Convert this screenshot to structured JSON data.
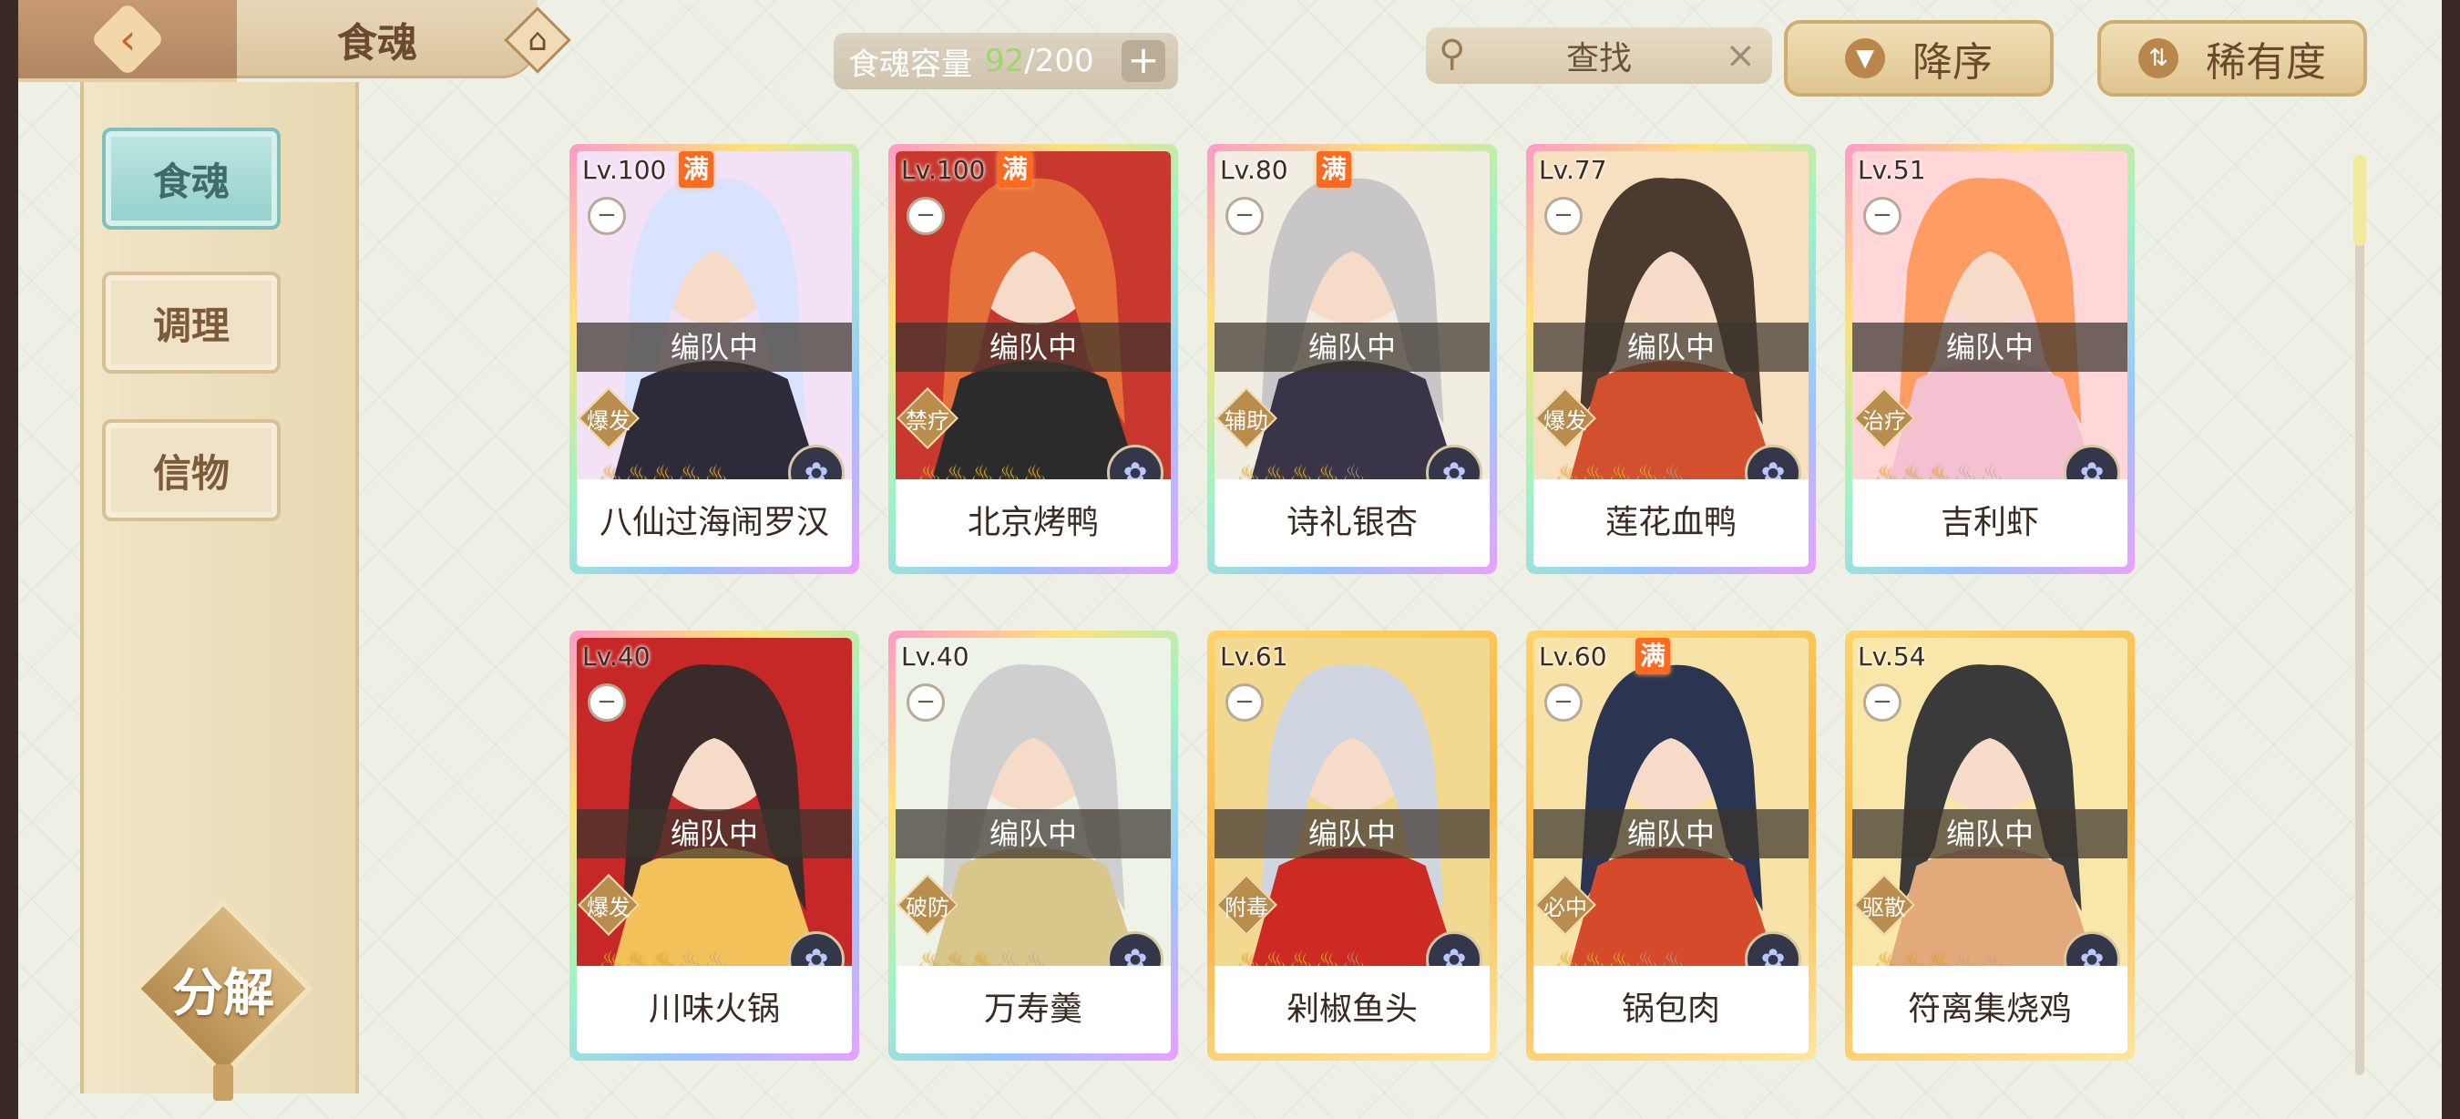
{
  "header": {
    "title": "食魂",
    "capacity_label": "食魂容量",
    "capacity_current": "92",
    "capacity_max": "/200",
    "capacity_add": "+",
    "search_placeholder": "查找",
    "search_clear": "×",
    "sort_order_label": "降序",
    "sort_key_label": "稀有度"
  },
  "sidebar": {
    "tabs": [
      {
        "label": "食魂",
        "active": true
      },
      {
        "label": "调理",
        "active": false
      },
      {
        "label": "信物",
        "active": false
      }
    ],
    "decompose_label": "分解"
  },
  "cards": [
    {
      "level": "Lv.100",
      "max": "满",
      "team": "编队中",
      "role": "爆发",
      "stars": 5,
      "name": "八仙过海闹罗汉",
      "rarity": "ur",
      "palette": [
        "#f3e1f5",
        "#d9e2ff",
        "#2d2a3a"
      ]
    },
    {
      "level": "Lv.100",
      "max": "满",
      "team": "编队中",
      "role": "禁疗",
      "stars": 5,
      "name": "北京烤鸭",
      "rarity": "ur",
      "palette": [
        "#c8382f",
        "#e6703a",
        "#2b2b2b"
      ]
    },
    {
      "level": "Lv.80",
      "max": "满",
      "team": "编队中",
      "role": "辅助",
      "stars": 4,
      "name": "诗礼银杏",
      "rarity": "ur",
      "palette": [
        "#f1ede2",
        "#c9c6c8",
        "#3a3448"
      ]
    },
    {
      "level": "Lv.77",
      "max": "",
      "team": "编队中",
      "role": "爆发",
      "stars": 4,
      "name": "莲花血鸭",
      "rarity": "ur",
      "palette": [
        "#f7e0c0",
        "#4a3a30",
        "#d2502e"
      ]
    },
    {
      "level": "Lv.51",
      "max": "",
      "team": "编队中",
      "role": "治疗",
      "stars": 3,
      "name": "吉利虾",
      "rarity": "ur",
      "palette": [
        "#ffd7d9",
        "#ff9c63",
        "#f4c1d1"
      ]
    },
    {
      "level": "Lv.40",
      "max": "",
      "team": "编队中",
      "role": "爆发",
      "stars": 3,
      "name": "川味火锅",
      "rarity": "ur",
      "palette": [
        "#c62727",
        "#3a2a2a",
        "#f2c15a"
      ]
    },
    {
      "level": "Lv.40",
      "max": "",
      "team": "编队中",
      "role": "破防",
      "stars": 3,
      "name": "万寿羹",
      "rarity": "ur",
      "palette": [
        "#eef3e8",
        "#cfcfcf",
        "#d8c68a"
      ]
    },
    {
      "level": "Lv.61",
      "max": "",
      "team": "编队中",
      "role": "附毒",
      "stars": 4,
      "name": "剁椒鱼头",
      "rarity": "sr",
      "palette": [
        "#f3d890",
        "#d0d6e0",
        "#cc2a22"
      ]
    },
    {
      "level": "Lv.60",
      "max": "满",
      "team": "编队中",
      "role": "必中",
      "stars": 3,
      "name": "锅包肉",
      "rarity": "sr",
      "palette": [
        "#f7e3a8",
        "#2b3450",
        "#d44a2a"
      ]
    },
    {
      "level": "Lv.54",
      "max": "",
      "team": "编队中",
      "role": "驱散",
      "stars": 3,
      "name": "符离集烧鸡",
      "rarity": "sr",
      "palette": [
        "#f8e7a8",
        "#3a3a3a",
        "#e2a97a"
      ]
    }
  ],
  "badge_icon": "flower-emblem-icon",
  "star_icon": "flame-star-icon"
}
